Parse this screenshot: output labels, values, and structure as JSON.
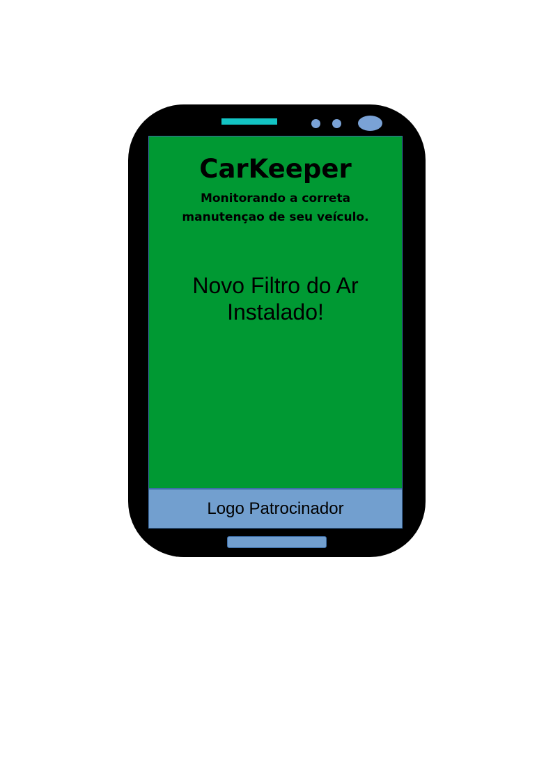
{
  "app": {
    "title": "CarKeeper",
    "subtitle_line1": "Monitorando a correta",
    "subtitle_line2": "manutençao de seu veículo."
  },
  "message": {
    "line1": "Novo Filtro do Ar",
    "line2": "Instalado!"
  },
  "sponsor": {
    "label": "Logo Patrocinador"
  },
  "colors": {
    "phone_body": "#000000",
    "screen_background": "#009933",
    "sponsor_bar": "#729fcf",
    "speaker": "#13c4c4",
    "sensors": "#7aa2d6"
  }
}
